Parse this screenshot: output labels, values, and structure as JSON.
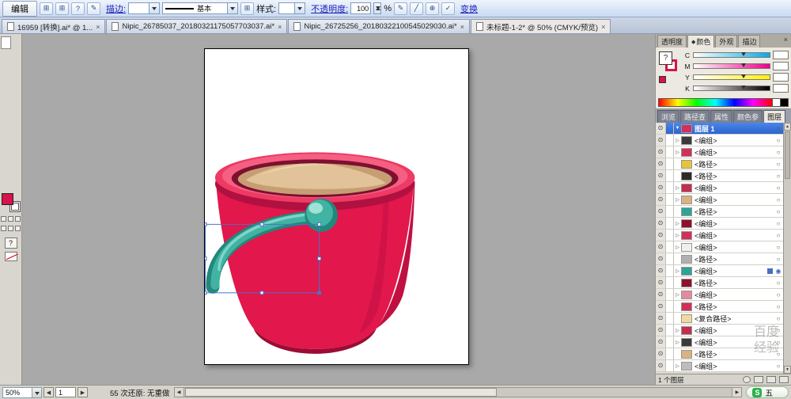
{
  "icons": {
    "eye": "⊙",
    "close": "×",
    "overflow": "»",
    "diamond": "◆",
    "help": "?",
    "pen": "✎",
    "slash": "╱",
    "globe": "⊕",
    "grid": "⊞",
    "check": "✓",
    "up": "▲",
    "down": "▼",
    "left": "◀",
    "right": "▶"
  },
  "menubar": {
    "edit": "编辑",
    "help": "?",
    "stroke_label": "描边:",
    "basic": "基本",
    "style_label": "样式:",
    "opacity_label": "不透明度:",
    "opacity_value": "100",
    "percent": "%",
    "transform": "变换"
  },
  "doc_tabs": [
    {
      "label": "16959 [转换].ai* @ 1..."
    },
    {
      "label": "Nipic_26785037_20180321175057703037.ai*"
    },
    {
      "label": "Nipic_26725256_20180322100545029030.ai*"
    },
    {
      "label": "未标题-1-2* @ 50% (CMYK/预览)",
      "active": true
    }
  ],
  "tools": [
    {
      "name": "selection-tool",
      "glyph": "↖",
      "active": true
    },
    {
      "name": "direct-selection-tool",
      "glyph": "▷"
    },
    {
      "name": "magic-wand-tool",
      "glyph": "✶"
    },
    {
      "name": "lasso-tool",
      "glyph": "◌"
    },
    {
      "name": "pen-tool",
      "glyph": "✒"
    },
    {
      "name": "type-tool",
      "glyph": "T"
    },
    {
      "name": "line-tool",
      "glyph": "╲"
    },
    {
      "name": "rectangle-tool",
      "glyph": "▭"
    },
    {
      "name": "pencil-tool",
      "glyph": "✎"
    },
    {
      "name": "rotate-tool",
      "glyph": "↻"
    },
    {
      "name": "scale-tool",
      "glyph": "⊿"
    },
    {
      "name": "warp-tool",
      "glyph": "≈"
    },
    {
      "name": "free-transform-tool",
      "glyph": "▱"
    },
    {
      "name": "symbol-sprayer-tool",
      "glyph": "✳"
    },
    {
      "name": "graph-tool",
      "glyph": "▥"
    },
    {
      "name": "mesh-tool",
      "glyph": "▦"
    },
    {
      "name": "gradient-tool",
      "glyph": "▤"
    },
    {
      "name": "eyedropper-tool",
      "glyph": "╱"
    },
    {
      "name": "blend-tool",
      "glyph": "◎"
    },
    {
      "name": "live-paint-bucket-tool",
      "glyph": "▨"
    },
    {
      "name": "live-paint-selection-tool",
      "glyph": "⊞"
    },
    {
      "name": "scissors-tool",
      "glyph": "✂"
    },
    {
      "name": "hand-tool",
      "glyph": "✥"
    },
    {
      "name": "zoom-tool",
      "glyph": "Q"
    }
  ],
  "panels": {
    "top_tabs": [
      {
        "label": "透明度"
      },
      {
        "label": "颜色",
        "active": true,
        "diamond": true
      },
      {
        "label": "外观"
      },
      {
        "label": "描边"
      }
    ],
    "color": {
      "channels": [
        {
          "label": "C",
          "color": "#00adee"
        },
        {
          "label": "M",
          "color": "#ec008c"
        },
        {
          "label": "Y",
          "color": "#fff200"
        },
        {
          "label": "K",
          "color": "#000000"
        }
      ]
    },
    "mid_tabs": [
      {
        "label": "浏览"
      },
      {
        "label": "路径查"
      },
      {
        "label": "属性"
      },
      {
        "label": "颜色参"
      },
      {
        "label": "图层",
        "active": true
      }
    ],
    "layers": {
      "footer": "1 个图层",
      "items": [
        {
          "label": "图层 1",
          "color": "#d1305a",
          "tri": "▼",
          "target": "○",
          "selected": true
        },
        {
          "label": "<编组>",
          "color": "#3a3a3a",
          "tri": "▷",
          "target": "○"
        },
        {
          "label": "<编组>",
          "color": "#d1305a",
          "tri": "▷",
          "target": "○"
        },
        {
          "label": "<路径>",
          "color": "#e7c33c",
          "tri": "",
          "target": "○"
        },
        {
          "label": "<路径>",
          "color": "#2b2b2b",
          "tri": "",
          "target": "○"
        },
        {
          "label": "<编组>",
          "color": "#c22d50",
          "tri": "▷",
          "target": "○"
        },
        {
          "label": "<编组>",
          "color": "#d9b183",
          "tri": "▷",
          "target": "○"
        },
        {
          "label": "<路径>",
          "color": "#2ea396",
          "tri": "",
          "target": "○"
        },
        {
          "label": "<编组>",
          "color": "#8e1030",
          "tri": "▷",
          "target": "○"
        },
        {
          "label": "<编组>",
          "color": "#d1305a",
          "tri": "▷",
          "target": "○"
        },
        {
          "label": "<编组>",
          "color": "#efefef",
          "tri": "▷",
          "target": "○"
        },
        {
          "label": "<路径>",
          "color": "#b0b0b0",
          "tri": "",
          "target": "○"
        },
        {
          "label": "<编组>",
          "color": "#2ea396",
          "tri": "▷",
          "target": "◉",
          "chip": true
        },
        {
          "label": "<路径>",
          "color": "#8e1030",
          "tri": "",
          "target": "○"
        },
        {
          "label": "<编组>",
          "color": "#e58a9d",
          "tri": "▷",
          "target": "○"
        },
        {
          "label": "<路径>",
          "color": "#d1305a",
          "tri": "",
          "target": "○"
        },
        {
          "label": "<复合路径>",
          "color": "#f0d9a0",
          "tri": "",
          "target": "○"
        },
        {
          "label": "<编组>",
          "color": "#c22d50",
          "tri": "▷",
          "target": "○"
        },
        {
          "label": "<编组>",
          "color": "#3a3a3a",
          "tri": "▷",
          "target": "○"
        },
        {
          "label": "<路径>",
          "color": "#d9b183",
          "tri": "",
          "target": "○"
        },
        {
          "label": "<编组>",
          "color": "#bdbdbd",
          "tri": "▷",
          "target": "○"
        }
      ]
    }
  },
  "statusbar": {
    "zoom": "50%",
    "page": "1",
    "undo": "55 次还原: 无重做"
  },
  "ime": {
    "logo": "S",
    "mode": "五",
    "tools": [
      {
        "glyph": "✎"
      },
      {
        "glyph": "▦"
      },
      {
        "glyph": "⚙"
      }
    ]
  },
  "watermark": {
    "text": "百度经验"
  },
  "colors": {
    "accent_blue": "#2c63cf",
    "bucket_red": "#e2174b",
    "handle_teal": "#41b3a3"
  }
}
